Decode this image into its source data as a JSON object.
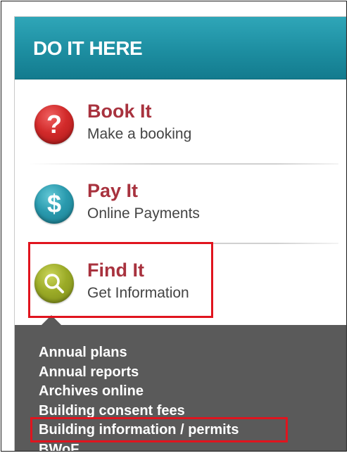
{
  "header": {
    "title": "DO IT HERE"
  },
  "items": [
    {
      "title": "Book It",
      "subtitle": "Make a booking",
      "icon": "question-icon",
      "glyph": "?",
      "color": "#d22a2a"
    },
    {
      "title": "Pay It",
      "subtitle": "Online Payments",
      "icon": "dollar-icon",
      "glyph": "$",
      "color": "#2a9aae"
    },
    {
      "title": "Find It",
      "subtitle": "Get Information",
      "icon": "magnifier-icon",
      "glyph": "",
      "color": "#9bab27"
    }
  ],
  "links": [
    "Annual plans",
    "Annual reports",
    "Archives online",
    "Building consent fees",
    "Building information / permits",
    "BWoF"
  ],
  "colors": {
    "header": "#1d8ea1",
    "title_text": "#a8323e",
    "dark_panel": "#5a5a5a",
    "highlight": "#e0141e"
  }
}
